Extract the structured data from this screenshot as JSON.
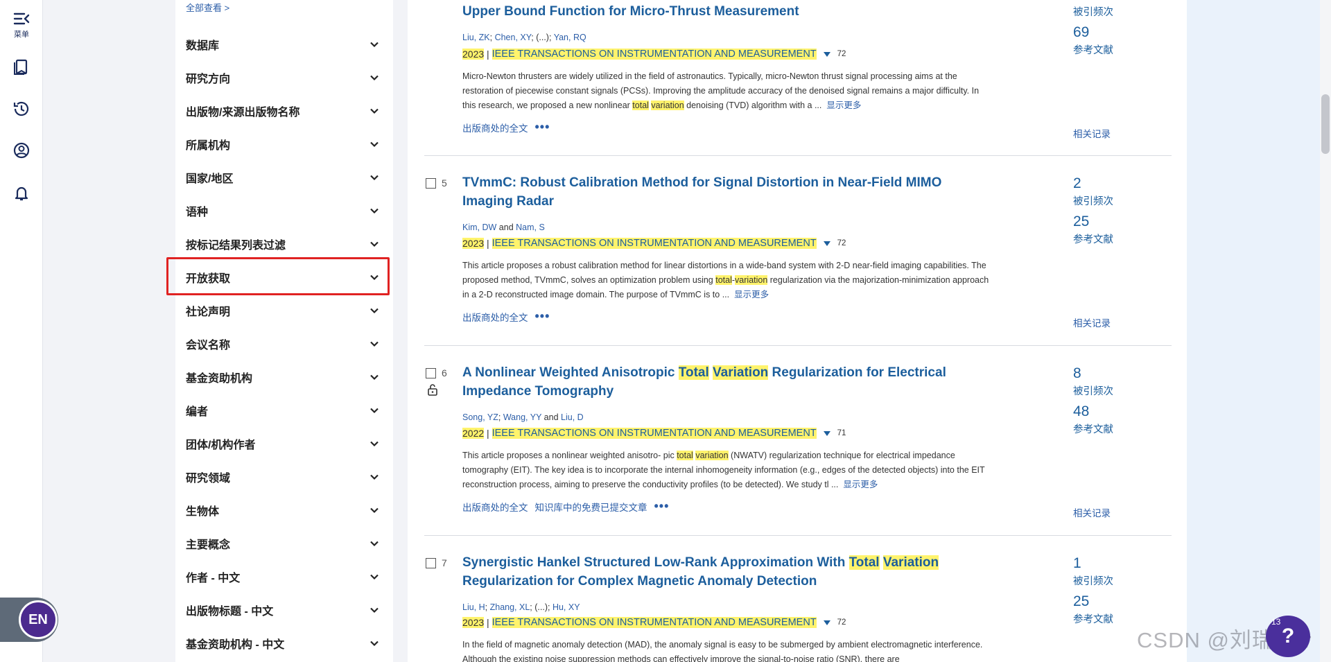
{
  "rail": {
    "menu_label": "菜单",
    "items": [
      "menu-icon",
      "bookmark-icon",
      "history-icon",
      "user-icon",
      "bell-icon"
    ],
    "lang_label": "EN"
  },
  "filters": {
    "see_all": "全部查看 >",
    "items": [
      "数据库",
      "研究方向",
      "出版物/来源出版物名称",
      "所属机构",
      "国家/地区",
      "语种",
      "按标记结果列表过滤",
      "开放获取",
      "社论声明",
      "会议名称",
      "基金资助机构",
      "编者",
      "团体/机构作者",
      "研究领域",
      "生物体",
      "主要概念",
      "作者 - 中文",
      "出版物标题 - 中文",
      "基金资助机构 - 中文"
    ]
  },
  "results": {
    "labels": {
      "citations": "被引频次",
      "references": "参考文献",
      "related": "相关记录",
      "publisher_fulltext": "出版商处的全文",
      "free_repo": "知识库中的免费已提交文章",
      "show_more": "显示更多",
      "more_dots": "•••"
    },
    "records": [
      {
        "title": "Upper Bound Function for Micro-Thrust Measurement",
        "authors_a": "Liu, ZK",
        "sep1": "; ",
        "authors_b": "Chen, XY",
        "sep2": "; (...); ",
        "authors_c": "Yan, RQ",
        "year": "2023",
        "journal": "IEEE TRANSACTIONS ON INSTRUMENTATION AND MEASUREMENT",
        "refs_count": "72",
        "abstract_1": "Micro-Newton thrusters are widely utilized in the field of astronautics. Typically, micro-Newton thrust signal processing aims at the restoration of piecewise constant signals (PCSs). Improving the amplitude accuracy of the denoised signal remains a major difficulty. In this research, we proposed a new nonlinear ",
        "abstract_hl1": "total",
        "abstract_hl2": "variation",
        "abstract_2": " denoising (TVD) algorithm with a ...",
        "citations": "",
        "references": "69"
      },
      {
        "number": "5",
        "title": "TVmmC: Robust Calibration Method for Signal Distortion in Near-Field MIMO Imaging Radar",
        "authors_a": "Kim, DW",
        "and": " and ",
        "authors_b": "Nam, S",
        "year": "2023",
        "journal": "IEEE TRANSACTIONS ON INSTRUMENTATION AND MEASUREMENT",
        "refs_count": "72",
        "abstract_1": "This article proposes a robust calibration method for linear distortions in a wide-band system with 2-D near-field imaging capabilities. The proposed method, TVmmC, solves an optimization problem using ",
        "abstract_hl1": "total",
        "abstract_dash": "-",
        "abstract_hl2": "variation",
        "abstract_2": " regularization via the majorization-minimization approach in a 2-D reconstructed image domain. The purpose of TVmmC is to ...",
        "citations": "2",
        "references": "25"
      },
      {
        "number": "6",
        "title_1": "A Nonlinear Weighted Anisotropic ",
        "title_hl1": "Total",
        "title_hl2": "Variation",
        "title_2": " Regularization for Electrical Impedance Tomography",
        "authors_a": "Song, YZ",
        "sep1": "; ",
        "authors_b": "Wang, YY",
        "and": " and ",
        "authors_c": "Liu, D",
        "year": "2022",
        "journal": "IEEE TRANSACTIONS ON INSTRUMENTATION AND MEASUREMENT",
        "refs_count": "71",
        "abstract_1": "This article proposes a nonlinear weighted anisotro- pic ",
        "abstract_hl1": "total",
        "abstract_hl2": "variation",
        "abstract_2": " (NWATV) regularization technique for electrical impedance tomography (EIT). The key idea is to incorporate the internal inhomogeneity information (e.g., edges of the detected objects) into the EIT reconstruction process, aiming to preserve the conductivity profiles (to be detected). We study tl ...",
        "citations": "8",
        "references": "48"
      },
      {
        "number": "7",
        "title_1": "Synergistic Hankel Structured Low-Rank Approximation With ",
        "title_hl1": "Total",
        "title_hl2": "Variation",
        "title_2": " Regularization for Complex Magnetic Anomaly Detection",
        "authors_a": "Liu, H",
        "sep1": "; ",
        "authors_b": "Zhang, XL",
        "sep2": "; (...); ",
        "authors_c": "Hu, XY",
        "year": "2023",
        "journal": "IEEE TRANSACTIONS ON INSTRUMENTATION AND MEASUREMENT",
        "refs_count": "72",
        "abstract_1": "In the field of magnetic anomaly detection (MAD), the anomaly signal is easy to be submerged by ambient electromagnetic interference. Although the existing noise suppression methods can effectively improve the signal-to-noise ratio (SNR), there are",
        "citations": "1",
        "references": "25"
      }
    ]
  },
  "overlay": {
    "watermark": "CSDN @刘瑞瑞rr",
    "help_count": "13",
    "help_label": "?"
  }
}
